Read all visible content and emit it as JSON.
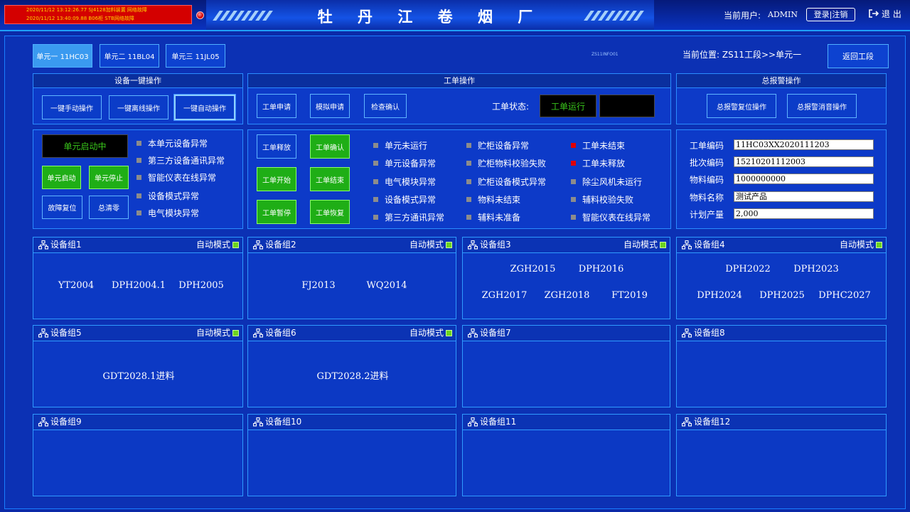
{
  "header": {
    "alarms": [
      "2020/11/12  13:12:26.77 SJ4128加料装置 网络故障",
      "2020/11/12  13:40:09.88 B06柜  STB网络故障"
    ],
    "title": "牡 丹 江 卷 烟 厂",
    "user_label": "当前用户:",
    "user_name": "ADMIN",
    "login_label": "登录|注销",
    "exit_label": "退 出"
  },
  "units": [
    {
      "label": "单元一 11HC03",
      "active": true
    },
    {
      "label": "单元二 11BL04",
      "active": false
    },
    {
      "label": "单元三 11JL05",
      "active": false
    }
  ],
  "small_label": "ZS11INFO01",
  "location": "当前位置: ZS11工段>>单元一",
  "back_label": "返回工段",
  "device_ops": {
    "title": "设备一键操作",
    "buttons": [
      "一键手动操作",
      "一键离线操作",
      "一键自动操作"
    ]
  },
  "order_ops": {
    "title": "工单操作",
    "buttons": [
      "工单申请",
      "模拟申请",
      "检查确认"
    ],
    "status_label": "工单状态:",
    "status_value": "工单运行"
  },
  "alarm_ops": {
    "title": "总报警操作",
    "buttons": [
      "总报警复位操作",
      "总报警消音操作"
    ]
  },
  "unit_ctrl": {
    "status": "单元启动中",
    "buttons": [
      "单元启动",
      "单元停止",
      "故障复位",
      "总清零"
    ],
    "indicators": [
      "本单元设备异常",
      "第三方设备通讯异常",
      "智能仪表在线异常",
      "设备模式异常",
      "电气模块异常"
    ]
  },
  "order_ctrl": {
    "buttons": [
      "工单释放",
      "工单确认",
      "工单开始",
      "工单结束",
      "工单暂停",
      "工单恢复"
    ],
    "col1": [
      "单元未运行",
      "单元设备异常",
      "电气模块异常",
      "设备模式异常",
      "第三方通讯异常"
    ],
    "col2": [
      "贮柜设备异常",
      "贮柜物料校验失败",
      "贮柜设备模式异常",
      "物料未结束",
      "辅料未准备"
    ],
    "col3": [
      "工单未结束",
      "工单未释放",
      "除尘风机未运行",
      "辅料校验失败",
      "智能仪表在线异常"
    ]
  },
  "order_info": {
    "fields": [
      {
        "label": "工单编码",
        "value": "11HC03XX2020111203"
      },
      {
        "label": "批次编码",
        "value": "15210201112003"
      },
      {
        "label": "物料编码",
        "value": "1000000000"
      },
      {
        "label": "物料名称",
        "value": "测试产品"
      },
      {
        "label": "计划产量",
        "value": "2,000"
      }
    ]
  },
  "mode_label": "自动模式",
  "groups": [
    {
      "name": "设备组1",
      "mode": true,
      "rows": [
        [
          "YT2004",
          "DPH2004.1",
          "DPH2005"
        ]
      ]
    },
    {
      "name": "设备组2",
      "mode": true,
      "rows": [
        [
          "FJ2013",
          "WQ2014"
        ]
      ]
    },
    {
      "name": "设备组3",
      "mode": true,
      "rows": [
        [
          "ZGH2015",
          "DPH2016"
        ],
        [
          "ZGH2017",
          "ZGH2018",
          "FT2019"
        ]
      ]
    },
    {
      "name": "设备组4",
      "mode": true,
      "rows": [
        [
          "DPH2022",
          "DPH2023"
        ],
        [
          "DPH2024",
          "DPH2025",
          "DPHC2027"
        ]
      ]
    },
    {
      "name": "设备组5",
      "mode": true,
      "rows": [
        [
          "GDT2028.1进料"
        ]
      ]
    },
    {
      "name": "设备组6",
      "mode": true,
      "rows": [
        [
          "GDT2028.2进料"
        ]
      ]
    },
    {
      "name": "设备组7",
      "mode": false,
      "rows": []
    },
    {
      "name": "设备组8",
      "mode": false,
      "rows": []
    },
    {
      "name": "设备组9",
      "mode": false,
      "rows": []
    },
    {
      "name": "设备组10",
      "mode": false,
      "rows": []
    },
    {
      "name": "设备组11",
      "mode": false,
      "rows": []
    },
    {
      "name": "设备组12",
      "mode": false,
      "rows": []
    }
  ]
}
